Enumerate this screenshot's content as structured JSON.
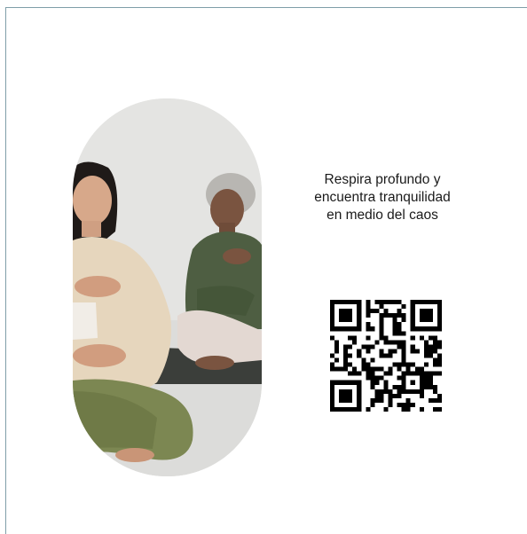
{
  "page": {
    "background": "#ffffff",
    "frame_color": "#7f9ea8"
  },
  "hero_image": {
    "icon": "meditation-photo",
    "alt": "Dos mujeres sentadas meditando con la mano en el pecho"
  },
  "tagline": {
    "text": "Respira profundo y\nencuentra tranquilidad\nen medio del caos"
  },
  "qr_code": {
    "icon": "qr-code-icon"
  }
}
